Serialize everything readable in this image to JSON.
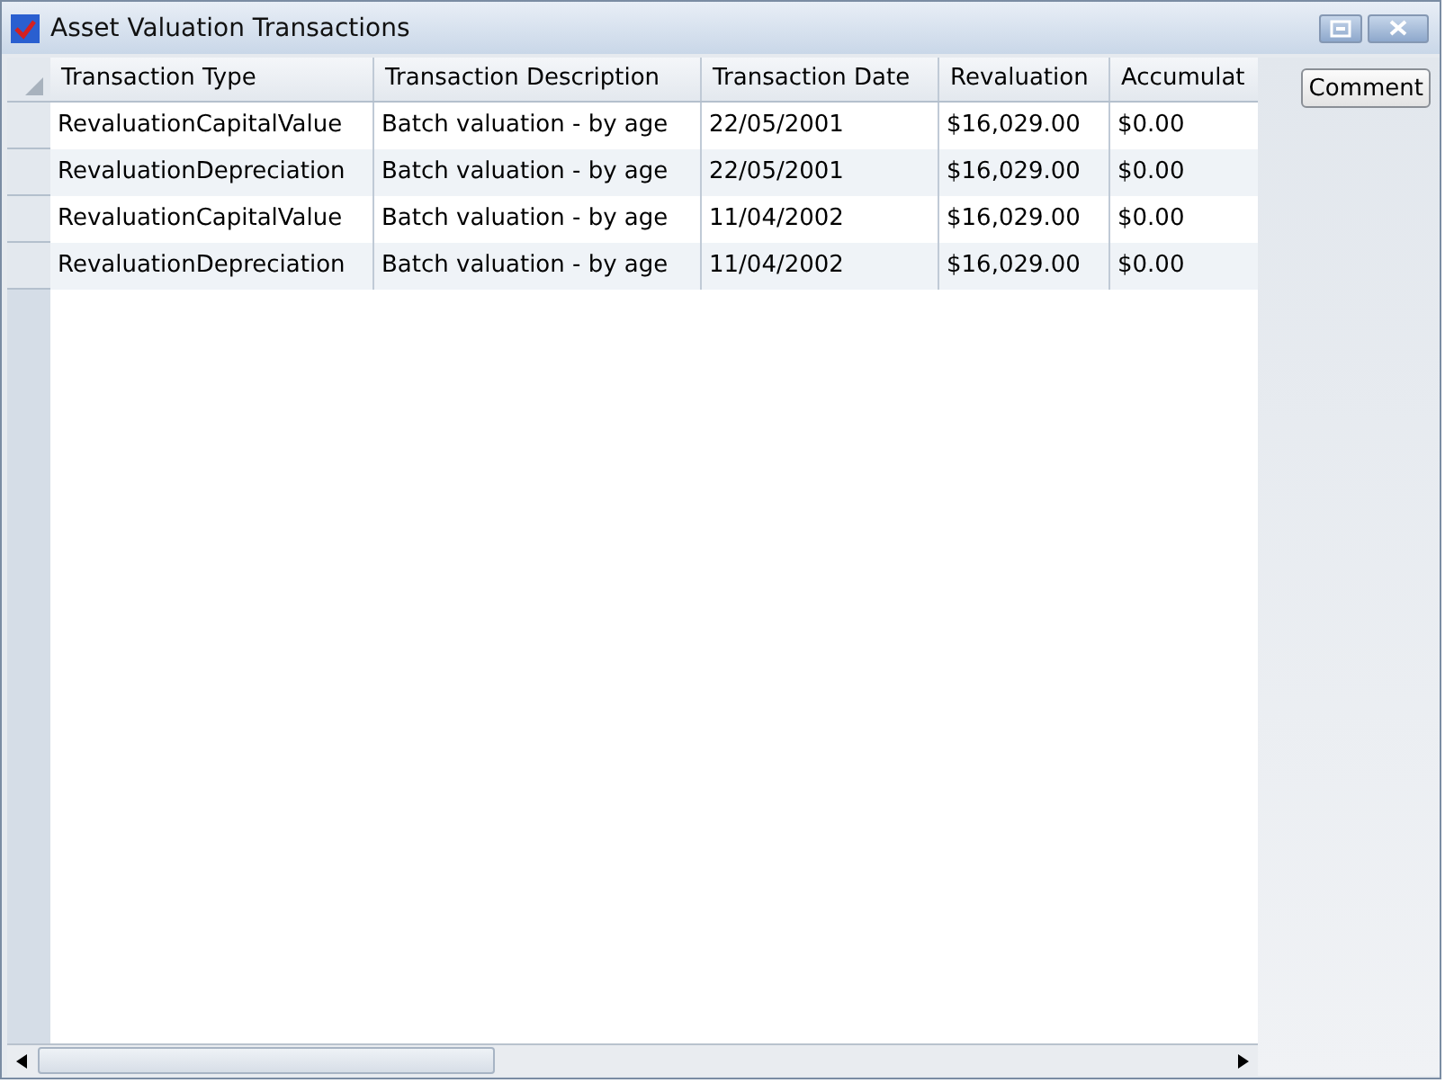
{
  "window": {
    "title": "Asset Valuation Transactions"
  },
  "table": {
    "columns": [
      "Transaction Type",
      "Transaction Description",
      "Transaction Date",
      "Revaluation",
      "Accumulat"
    ],
    "rows": [
      [
        "RevaluationCapitalValue",
        "Batch valuation - by age",
        "22/05/2001",
        "$16,029.00",
        "$0.00"
      ],
      [
        "RevaluationDepreciation",
        "Batch valuation - by age",
        "22/05/2001",
        "$16,029.00",
        "$0.00"
      ],
      [
        "RevaluationCapitalValue",
        "Batch valuation - by age",
        "11/04/2002",
        "$16,029.00",
        "$0.00"
      ],
      [
        "RevaluationDepreciation",
        "Batch valuation - by age",
        "11/04/2002",
        "$16,029.00",
        "$0.00"
      ]
    ]
  },
  "buttons": [
    "Comment"
  ]
}
